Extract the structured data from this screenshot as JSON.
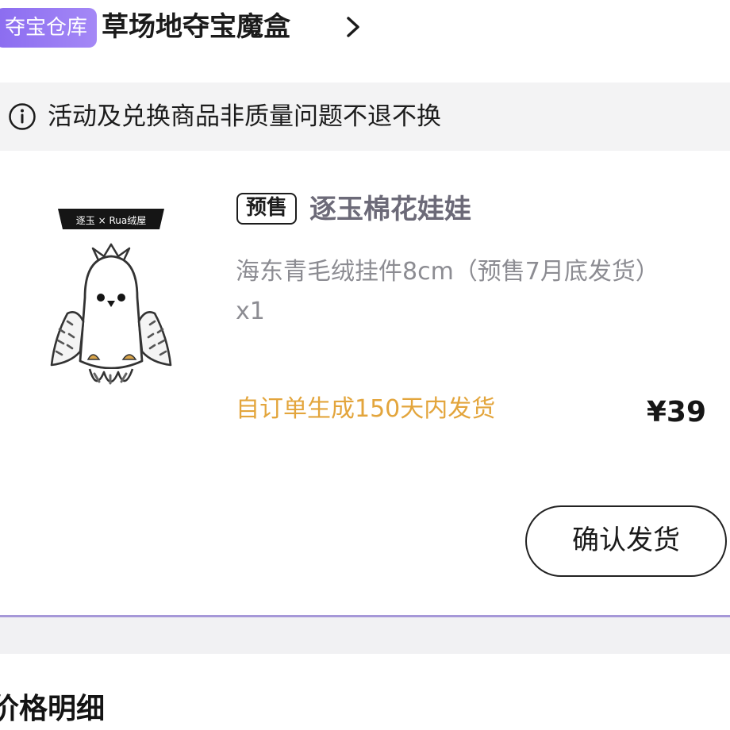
{
  "header": {
    "shop_badge": "夺宝仓库",
    "shop_title": "草场地夺宝魔盒"
  },
  "notice": {
    "text": "活动及兑换商品非质量问题不退不换"
  },
  "product": {
    "presale_badge": "预售",
    "title": "逐玉棉花娃娃",
    "spec": "海东青毛绒挂件8cm（预售7月底发货） x1",
    "shipping_note": "自订单生成150天内发货",
    "price": "¥39",
    "image_banner_text": "逐玉 × Rua绒屋"
  },
  "actions": {
    "confirm_label": "确认发货"
  },
  "details": {
    "heading": "价格明细"
  },
  "colors": {
    "accent": "#8b6cf0",
    "shipping_note": "#e3a53c",
    "divider": "#a698d8"
  },
  "icons": {
    "header_arrow": "chevron-right-icon",
    "notice": "info-icon"
  }
}
